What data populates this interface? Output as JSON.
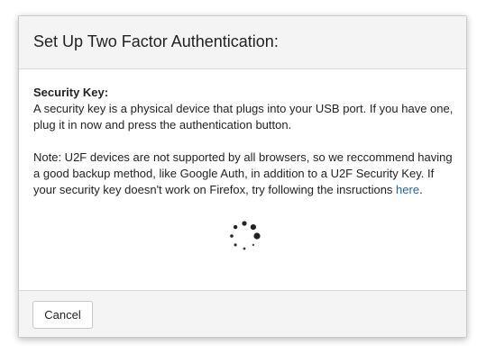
{
  "dialog": {
    "title": "Set Up Two Factor Authentication:",
    "section_heading": "Security Key:",
    "paragraph_1": "A security key is a physical device that plugs into your USB port. If you have one, plug it in now and press the authentication button.",
    "paragraph_2_text": "Note: U2F devices are not supported by all browsers, so we reccommend having a good backup method, like Google Auth, in addition to a U2F Security Key. If your security key doesn't work on Firefox, try following the insructions ",
    "paragraph_2_link": "here",
    "paragraph_2_end": ".",
    "spinner_icon": "loading-spinner-icon",
    "cancel_label": "Cancel"
  },
  "colors": {
    "header_bg": "#f4f4f4",
    "footer_bg": "#f4f4f4",
    "link": "#2a6496",
    "text": "#222222",
    "border": "#d9d9d9"
  }
}
